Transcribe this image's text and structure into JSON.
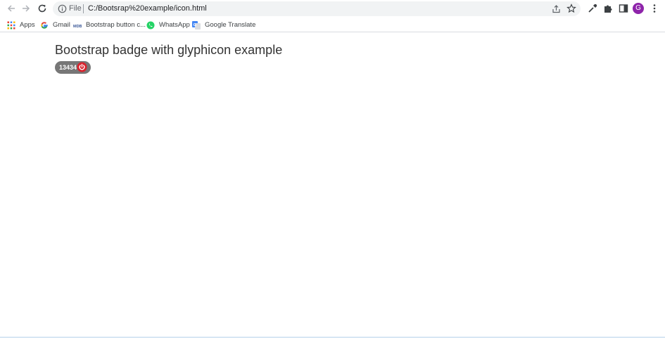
{
  "browser": {
    "omnibox": {
      "scheme_label": "File",
      "url": "C:/Bootsrap%20example/icon.html"
    },
    "profile_initial": "G",
    "icons": {
      "back": "arrow-left-icon",
      "forward": "arrow-right-icon",
      "reload": "reload-icon",
      "info": "info-icon",
      "share": "share-icon",
      "bookmark_star": "star-icon",
      "eyedropper": "eyedropper-icon",
      "extensions": "puzzle-icon",
      "side_panel": "side-panel-icon",
      "menu": "kebab-menu-icon"
    }
  },
  "bookmarks": [
    {
      "label": "Apps",
      "icon": "apps-grid-icon"
    },
    {
      "label": "Gmail",
      "icon": "google-icon"
    },
    {
      "label": "Bootstrap button c...",
      "icon": "mdb-icon"
    },
    {
      "label": "WhatsApp",
      "icon": "whatsapp-icon"
    },
    {
      "label": "Google Translate",
      "icon": "google-translate-icon"
    }
  ],
  "page": {
    "heading": "Bootstrap badge with glyphicon example",
    "badge": {
      "count": "13434",
      "glyph": "power-off-icon"
    }
  },
  "colors": {
    "badge_bg": "#777777",
    "glyph_bg": "#d9232d",
    "avatar_bg": "#8e24aa",
    "omnibox_bg": "#f1f3f4"
  }
}
